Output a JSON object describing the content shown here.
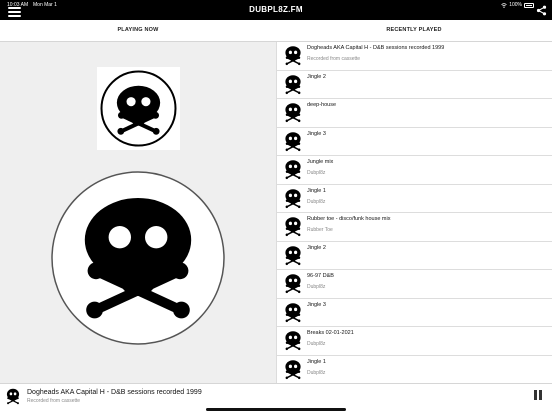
{
  "status_bar": {
    "time": "10:03 AM",
    "date": "Mon Mar 1",
    "battery": "100%"
  },
  "app_title": "DUBPL8Z.FM",
  "icons": {
    "menu": "hamburger-menu-icon",
    "share": "share-icon",
    "logo": "skull-crossbones-icon",
    "pause": "pause-icon"
  },
  "tabs": {
    "playing_now": "PLAYING NOW",
    "recently_played": "RECENTLY PLAYED"
  },
  "recently_played": [
    {
      "title": "Dogheads AKA Capital H - D&B sessions recorded 1999",
      "subtitle": "Recorded from cassette"
    },
    {
      "title": "Jingle 2",
      "subtitle": ""
    },
    {
      "title": "deep-house",
      "subtitle": ""
    },
    {
      "title": "Jingle 3",
      "subtitle": ""
    },
    {
      "title": "Jungle mix",
      "subtitle": "Dubpl8z"
    },
    {
      "title": "Jingle 1",
      "subtitle": "Dubpl8z"
    },
    {
      "title": "Rubber toe - disco/funk house mix",
      "subtitle": "Rubber Toe"
    },
    {
      "title": "Jingle 2",
      "subtitle": ""
    },
    {
      "title": "96-97 D&B",
      "subtitle": "Dubpl8z"
    },
    {
      "title": "Jingle 3",
      "subtitle": ""
    },
    {
      "title": "Breaks 02-01-2021",
      "subtitle": "Dubpl8z"
    },
    {
      "title": "Jingle 1",
      "subtitle": "Dubpl8z"
    }
  ],
  "now_playing": {
    "title": "Dogheads AKA Capital H - D&B sessions recorded 1999",
    "subtitle": "Recorded from cassette"
  }
}
